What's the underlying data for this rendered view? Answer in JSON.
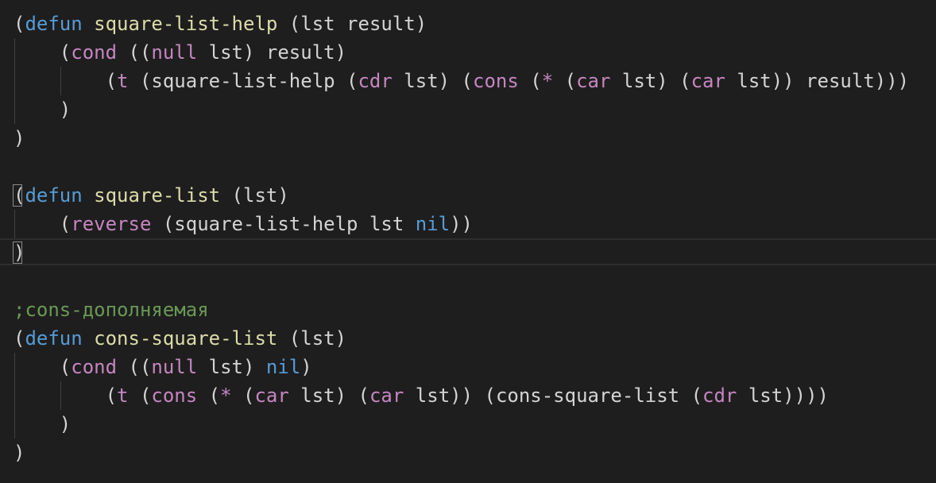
{
  "editor": {
    "lines": [
      {
        "tokens": [
          {
            "t": "(",
            "c": "pl"
          },
          {
            "t": "defun",
            "c": "kw"
          },
          {
            "t": " ",
            "c": "pl"
          },
          {
            "t": "square-list-help",
            "c": "fn"
          },
          {
            "t": " (lst result)",
            "c": "pl"
          }
        ]
      },
      {
        "tokens": [
          {
            "t": "    (",
            "c": "pl"
          },
          {
            "t": "cond",
            "c": "ctl"
          },
          {
            "t": " ((",
            "c": "pl"
          },
          {
            "t": "null",
            "c": "ctl"
          },
          {
            "t": " lst) result)",
            "c": "pl"
          }
        ]
      },
      {
        "tokens": [
          {
            "t": "        (",
            "c": "pl"
          },
          {
            "t": "t",
            "c": "ctl"
          },
          {
            "t": " (square-list-help (",
            "c": "pl"
          },
          {
            "t": "cdr",
            "c": "ctl"
          },
          {
            "t": " lst) (",
            "c": "pl"
          },
          {
            "t": "cons",
            "c": "ctl"
          },
          {
            "t": " (",
            "c": "pl"
          },
          {
            "t": "*",
            "c": "ctl"
          },
          {
            "t": " (",
            "c": "pl"
          },
          {
            "t": "car",
            "c": "ctl"
          },
          {
            "t": " lst) (",
            "c": "pl"
          },
          {
            "t": "car",
            "c": "ctl"
          },
          {
            "t": " lst)) result)))",
            "c": "pl"
          }
        ]
      },
      {
        "tokens": [
          {
            "t": "    )",
            "c": "pl"
          }
        ]
      },
      {
        "tokens": [
          {
            "t": ")",
            "c": "pl"
          }
        ]
      },
      {
        "tokens": []
      },
      {
        "tokens": [
          {
            "t": "(",
            "c": "pl"
          },
          {
            "t": "defun",
            "c": "kw"
          },
          {
            "t": " ",
            "c": "pl"
          },
          {
            "t": "square-list",
            "c": "fn"
          },
          {
            "t": " (lst)",
            "c": "pl"
          }
        ]
      },
      {
        "tokens": [
          {
            "t": "    (",
            "c": "pl"
          },
          {
            "t": "reverse",
            "c": "ctl"
          },
          {
            "t": " (square-list-help lst ",
            "c": "pl"
          },
          {
            "t": "nil",
            "c": "kw"
          },
          {
            "t": "))",
            "c": "pl"
          }
        ]
      },
      {
        "tokens": [
          {
            "t": ")",
            "c": "pl"
          }
        ]
      },
      {
        "tokens": []
      },
      {
        "tokens": [
          {
            "t": ";cons-дополняемая",
            "c": "cm"
          }
        ]
      },
      {
        "tokens": [
          {
            "t": "(",
            "c": "pl"
          },
          {
            "t": "defun",
            "c": "kw"
          },
          {
            "t": " ",
            "c": "pl"
          },
          {
            "t": "cons-square-list",
            "c": "fn"
          },
          {
            "t": " (lst)",
            "c": "pl"
          }
        ]
      },
      {
        "tokens": [
          {
            "t": "    (",
            "c": "pl"
          },
          {
            "t": "cond",
            "c": "ctl"
          },
          {
            "t": " ((",
            "c": "pl"
          },
          {
            "t": "null",
            "c": "ctl"
          },
          {
            "t": " lst) ",
            "c": "pl"
          },
          {
            "t": "nil",
            "c": "kw"
          },
          {
            "t": ")",
            "c": "pl"
          }
        ]
      },
      {
        "tokens": [
          {
            "t": "        (",
            "c": "pl"
          },
          {
            "t": "t",
            "c": "ctl"
          },
          {
            "t": " (",
            "c": "pl"
          },
          {
            "t": "cons",
            "c": "ctl"
          },
          {
            "t": " (",
            "c": "pl"
          },
          {
            "t": "*",
            "c": "ctl"
          },
          {
            "t": " (",
            "c": "pl"
          },
          {
            "t": "car",
            "c": "ctl"
          },
          {
            "t": " lst) (",
            "c": "pl"
          },
          {
            "t": "car",
            "c": "ctl"
          },
          {
            "t": " lst)) (cons-square-list (",
            "c": "pl"
          },
          {
            "t": "cdr",
            "c": "ctl"
          },
          {
            "t": " lst))))",
            "c": "pl"
          }
        ]
      },
      {
        "tokens": [
          {
            "t": "    )",
            "c": "pl"
          }
        ]
      },
      {
        "tokens": [
          {
            "t": ")",
            "c": "pl"
          }
        ]
      }
    ],
    "current_line": 9
  },
  "colors": {
    "background": "#1e1e1e",
    "keyword": "#569cd6",
    "function_name": "#dcdcaa",
    "control": "#c586c0",
    "comment": "#6a9955",
    "plain": "#d4d4d4"
  }
}
